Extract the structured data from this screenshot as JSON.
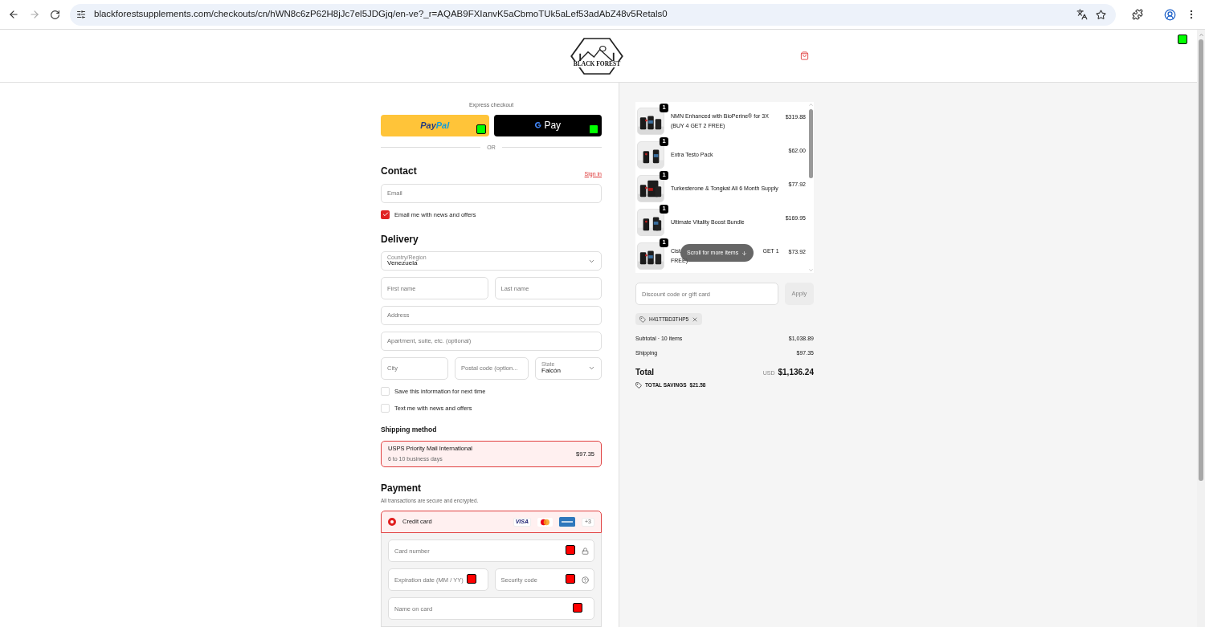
{
  "browser": {
    "url": "blackforestsupplements.com/checkouts/cn/hWN8c6zP62H8jJc7el5JDGjq/en-ve?_r=AQAB9FXIanvK5aCbmoTUk5aLef53adAbZ48v5Retals0"
  },
  "header": {
    "logo_text": "BLACK FOREST"
  },
  "express": {
    "title": "Express checkout",
    "paypal": {
      "part1": "Pay",
      "part2": "Pal"
    },
    "gpay": "Pay",
    "divider": "OR"
  },
  "contact": {
    "title": "Contact",
    "sign_in": "Sign in",
    "email": {
      "placeholder": "Email"
    },
    "news": {
      "label": "Email me with news and offers",
      "checked": true
    }
  },
  "delivery": {
    "title": "Delivery",
    "country": {
      "label": "Country/Region",
      "value": "Venezuela"
    },
    "first_name": {
      "placeholder": "First name"
    },
    "last_name": {
      "placeholder": "Last name"
    },
    "address": {
      "placeholder": "Address"
    },
    "apartment": {
      "placeholder": "Apartment, suite, etc. (optional)"
    },
    "city": {
      "placeholder": "City"
    },
    "postal": {
      "placeholder": "Postal code (option..."
    },
    "state": {
      "label": "State",
      "value": "Falcón"
    },
    "options": [
      {
        "label": "Save this information for next time",
        "checked": false
      },
      {
        "label": "Text me with news and offers",
        "checked": false
      }
    ]
  },
  "shipping": {
    "title": "Shipping method",
    "options": [
      {
        "name": "USPS Priority Mail International",
        "detail": "6 to 10 business days",
        "price": "$97.35",
        "selected": true
      }
    ]
  },
  "payment": {
    "title": "Payment",
    "subtitle": "All transactions are secure and encrypted.",
    "methods": [
      {
        "label": "Credit card",
        "selected": true,
        "visa": "VISA",
        "more": "+3"
      }
    ],
    "fields": [
      {
        "placeholder": "Card number",
        "kind": "lock"
      },
      {
        "placeholder": "Expiration date (MM / YY)",
        "kind": "plain"
      },
      {
        "placeholder": "Security code",
        "kind": "help"
      },
      {
        "placeholder": "Name on card",
        "kind": "plain"
      }
    ]
  },
  "cart": {
    "items": [
      {
        "kind": "full",
        "qty": "1",
        "name": "NMN Enhanced with BioPerine® for 3X (BUY 4 GET 2 FREE)",
        "price": "$319.88"
      },
      {
        "kind": "full",
        "qty": "1",
        "name": "Extra Testo Pack",
        "price": "$62.00"
      },
      {
        "kind": "full",
        "qty": "1",
        "name": "Turkesterone & Tongkat Ali 6 Month Supply",
        "price": "$77.92"
      },
      {
        "kind": "full",
        "qty": "1",
        "name": "Ultimate Vitality Boost Bundle",
        "price": "$169.95"
      },
      {
        "kind": "covered",
        "qty": "1",
        "fragments": [
          "Cist",
          "GET 1",
          "FREE)"
        ],
        "price": "$73.92"
      }
    ],
    "scroll_hint": "Scroll for more items",
    "discount": {
      "placeholder": "Discount code or gift card",
      "button": "Apply"
    },
    "code": "H41TTBD3THP5",
    "summary": [
      {
        "label": "Subtotal · 10 items",
        "value": "$1,038.89"
      },
      {
        "label": "Shipping",
        "value": "$97.35"
      }
    ],
    "total": {
      "label": "Total",
      "currency": "USD",
      "value": "$1,136.24"
    },
    "savings": {
      "label": "TOTAL SAVINGS",
      "value": "$21.58"
    }
  }
}
